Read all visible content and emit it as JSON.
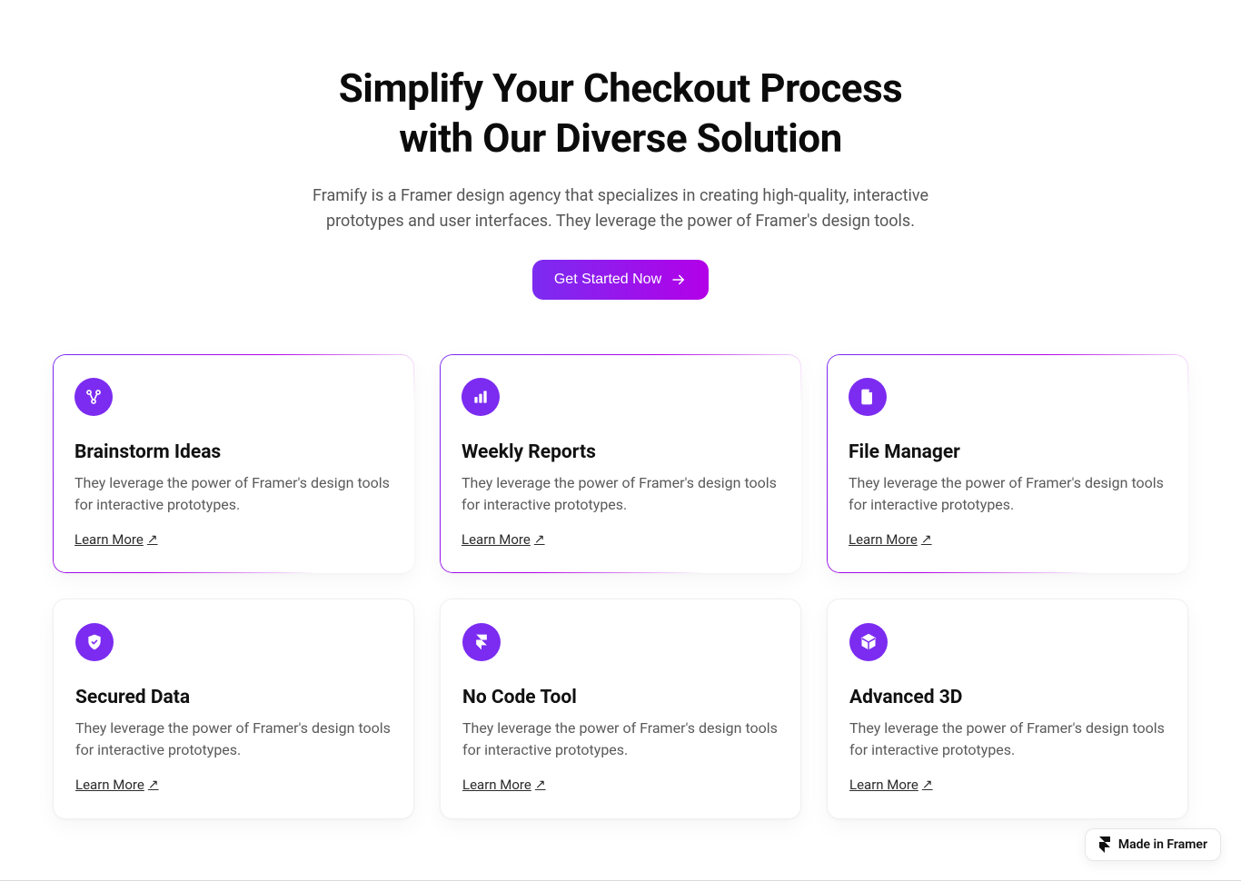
{
  "hero": {
    "title_line1": "Simplify Your Checkout Process",
    "title_line2": "with Our Diverse Solution",
    "subtitle": "Framify is a Framer design agency that specializes in creating high-quality, interactive prototypes and user interfaces. They leverage the power of Framer's design tools.",
    "cta_label": "Get Started Now"
  },
  "features": [
    {
      "icon": "branches-icon",
      "title": "Brainstorm Ideas",
      "desc": "They leverage the power of Framer's design tools for interactive prototypes.",
      "link_label": "Learn More",
      "gradient": true
    },
    {
      "icon": "bar-chart-icon",
      "title": "Weekly Reports",
      "desc": "They leverage the power of Framer's design tools for interactive prototypes.",
      "link_label": "Learn More",
      "gradient": true
    },
    {
      "icon": "file-icon",
      "title": "File Manager",
      "desc": "They leverage the power of Framer's design tools for interactive prototypes.",
      "link_label": "Learn More",
      "gradient": true
    },
    {
      "icon": "shield-check-icon",
      "title": "Secured Data",
      "desc": "They leverage the power of Framer's design tools for interactive prototypes.",
      "link_label": "Learn More",
      "gradient": false
    },
    {
      "icon": "framer-logo-icon",
      "title": "No Code Tool",
      "desc": "They leverage the power of Framer's design tools for interactive prototypes.",
      "link_label": "Learn More",
      "gradient": false
    },
    {
      "icon": "cube-icon",
      "title": "Advanced 3D",
      "desc": "They leverage the power of Framer's design tools for interactive prototypes.",
      "link_label": "Learn More",
      "gradient": false
    }
  ],
  "badge": {
    "label": "Made in Framer"
  },
  "colors": {
    "accent_start": "#7B2CF0",
    "accent_end": "#B300E8"
  }
}
